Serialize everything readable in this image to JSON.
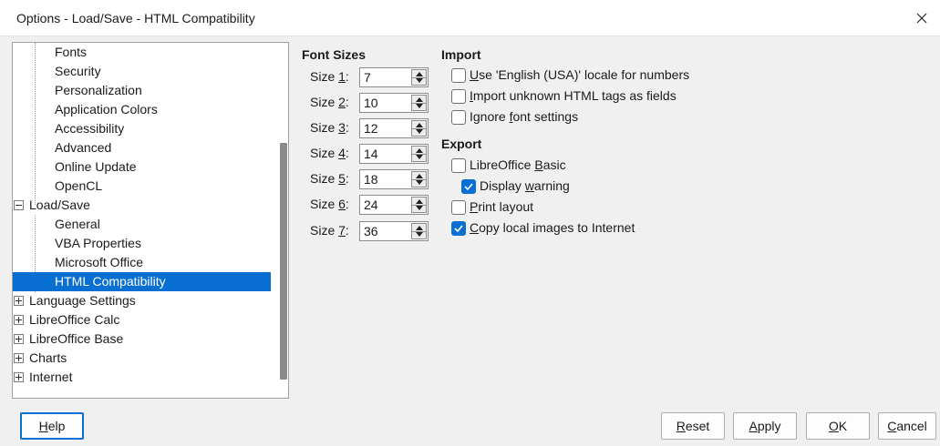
{
  "window": {
    "title": "Options - Load/Save - HTML Compatibility"
  },
  "tree": {
    "items": [
      {
        "label": "Fonts",
        "level": 1
      },
      {
        "label": "Security",
        "level": 1
      },
      {
        "label": "Personalization",
        "level": 1
      },
      {
        "label": "Application Colors",
        "level": 1
      },
      {
        "label": "Accessibility",
        "level": 1
      },
      {
        "label": "Advanced",
        "level": 1
      },
      {
        "label": "Online Update",
        "level": 1
      },
      {
        "label": "OpenCL",
        "level": 1
      },
      {
        "label": "Load/Save",
        "level": 0,
        "expanded": true
      },
      {
        "label": "General",
        "level": 1
      },
      {
        "label": "VBA Properties",
        "level": 1
      },
      {
        "label": "Microsoft Office",
        "level": 1
      },
      {
        "label": "HTML Compatibility",
        "level": 1,
        "selected": true
      },
      {
        "label": "Language Settings",
        "level": 0,
        "expanded": false
      },
      {
        "label": "LibreOffice Calc",
        "level": 0,
        "expanded": false
      },
      {
        "label": "LibreOffice Base",
        "level": 0,
        "expanded": false
      },
      {
        "label": "Charts",
        "level": 0,
        "expanded": false
      },
      {
        "label": "Internet",
        "level": 0,
        "expanded": false
      }
    ]
  },
  "font_sizes": {
    "heading": "Font Sizes",
    "rows": [
      {
        "prefix": "Size ",
        "key": "1",
        "suffix": ":",
        "value": "7"
      },
      {
        "prefix": "Size ",
        "key": "2",
        "suffix": ":",
        "value": "10"
      },
      {
        "prefix": "Size ",
        "key": "3",
        "suffix": ":",
        "value": "12"
      },
      {
        "prefix": "Size ",
        "key": "4",
        "suffix": ":",
        "value": "14"
      },
      {
        "prefix": "Size ",
        "key": "5",
        "suffix": ":",
        "value": "18"
      },
      {
        "prefix": "Size ",
        "key": "6",
        "suffix": ":",
        "value": "24"
      },
      {
        "prefix": "Size ",
        "key": "7",
        "suffix": ":",
        "value": "36"
      }
    ]
  },
  "import": {
    "heading": "Import",
    "options": [
      {
        "key": "U",
        "rest": "se 'English (USA)' locale for numbers",
        "checked": false
      },
      {
        "key": "I",
        "rest": "mport unknown HTML tags as fields",
        "checked": false
      },
      {
        "pre": "Ignore ",
        "key": "f",
        "rest": "ont settings",
        "checked": false
      }
    ]
  },
  "export": {
    "heading": "Export",
    "options": [
      {
        "pre": "LibreOffice ",
        "key": "B",
        "rest": "asic",
        "checked": false
      },
      {
        "pre": "Display ",
        "key": "w",
        "rest": "arning",
        "checked": true,
        "indent": true
      },
      {
        "key": "P",
        "rest": "rint layout",
        "checked": false
      },
      {
        "key": "C",
        "rest": "opy local images to Internet",
        "checked": true
      }
    ]
  },
  "buttons": {
    "help": {
      "key": "H",
      "rest": "elp"
    },
    "reset": {
      "key": "R",
      "rest": "eset"
    },
    "apply": {
      "key": "A",
      "rest": "pply"
    },
    "ok": {
      "key": "O",
      "rest": "K"
    },
    "cancel": {
      "key": "C",
      "rest": "ancel"
    }
  },
  "colors": {
    "accent": "#0a6fd2"
  }
}
